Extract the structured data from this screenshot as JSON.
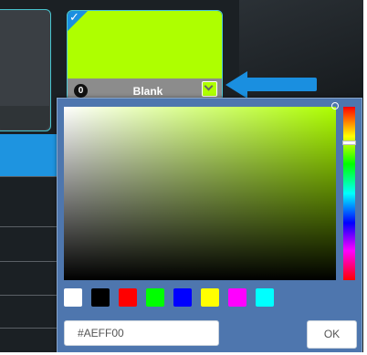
{
  "card": {
    "name": "Blank",
    "count": "0",
    "color": "#AEFF00",
    "check_glyph": "✓",
    "selected": true
  },
  "picker": {
    "hue_color": "#AEFF00",
    "hex_value": "#AEFF00",
    "ok_label": "OK",
    "presets": [
      "#FFFFFF",
      "#000000",
      "#FF0000",
      "#00FF00",
      "#0000FF",
      "#FFFF00",
      "#FF00FF",
      "#00FFFF"
    ]
  },
  "colors": {
    "accent_blue": "#1A8FE0",
    "selection_border": "#4CC7D5",
    "picker_bg": "#4E76AE"
  },
  "icons": {
    "arrow": "left-arrow-icon",
    "check": "checkmark-icon",
    "swatch_dropdown": "chevron-down-icon"
  }
}
